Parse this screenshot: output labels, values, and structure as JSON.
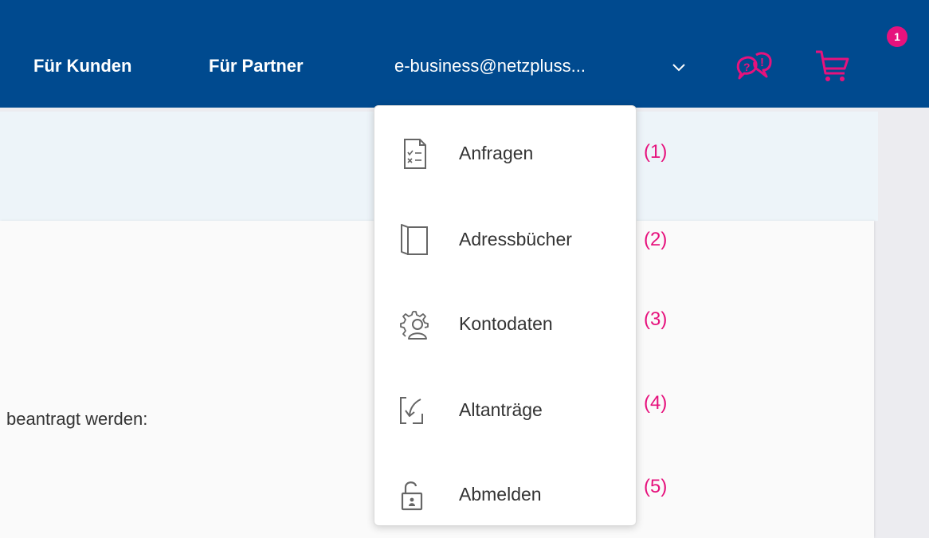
{
  "header": {
    "nav": [
      {
        "label": "Für Kunden"
      },
      {
        "label": "Für Partner"
      }
    ],
    "user_menu": {
      "label": "e-business@netzpluss...",
      "icon": "chevron-down-icon"
    },
    "help_icon": "help-chat-icon",
    "cart": {
      "icon": "shopping-cart-icon",
      "badge": "1"
    }
  },
  "page": {
    "body_text": "beantragt werden:"
  },
  "dropdown": {
    "items": [
      {
        "label": "Anfragen",
        "icon": "request-list-icon",
        "annotation": "(1)"
      },
      {
        "label": "Adressbücher",
        "icon": "book-icon",
        "annotation": "(2)"
      },
      {
        "label": "Kontodaten",
        "icon": "account-settings-icon",
        "annotation": "(3)"
      },
      {
        "label": "Altanträge",
        "icon": "old-requests-icon",
        "annotation": "(4)"
      },
      {
        "label": "Abmelden",
        "icon": "unlock-icon",
        "annotation": "(5)"
      }
    ]
  },
  "colors": {
    "header_bg": "#004a8f",
    "accent": "#e6127d",
    "band_bg": "#edf4f9"
  }
}
